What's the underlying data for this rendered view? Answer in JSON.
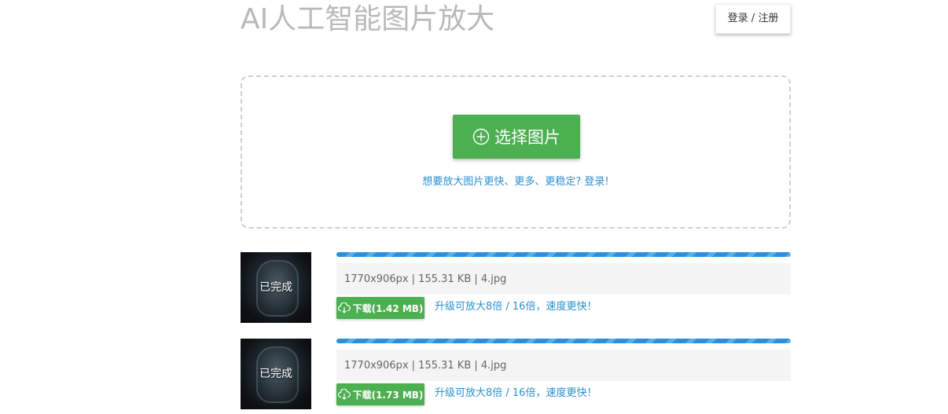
{
  "header": {
    "title": "AI人工智能图片放大",
    "login_label": "登录 / 注册"
  },
  "upload": {
    "select_label": "选择图片",
    "hint_link": "想要放大图片更快、更多、更稳定? 登录!"
  },
  "items": [
    {
      "status": "已完成",
      "progress": 1.0,
      "info": "1770x906px | 155.31 KB | 4.jpg",
      "download_label": "下载(1.42 MB)",
      "upgrade_label": "升级可放大8倍 / 16倍，速度更快！"
    },
    {
      "status": "已完成",
      "progress": 1.0,
      "info": "1770x906px | 155.31 KB | 4.jpg",
      "download_label": "下载(1.73 MB)",
      "upgrade_label": "升级可放大8倍 / 16倍，速度更快！"
    }
  ],
  "colors": {
    "primary_green": "#4caf50",
    "link_blue": "#2a8fcf",
    "progress_blue": "#2d8fd8",
    "title_gray": "#b9b9b9"
  },
  "icons": {
    "select": "plus-circle-icon",
    "download": "cloud-download-icon"
  }
}
